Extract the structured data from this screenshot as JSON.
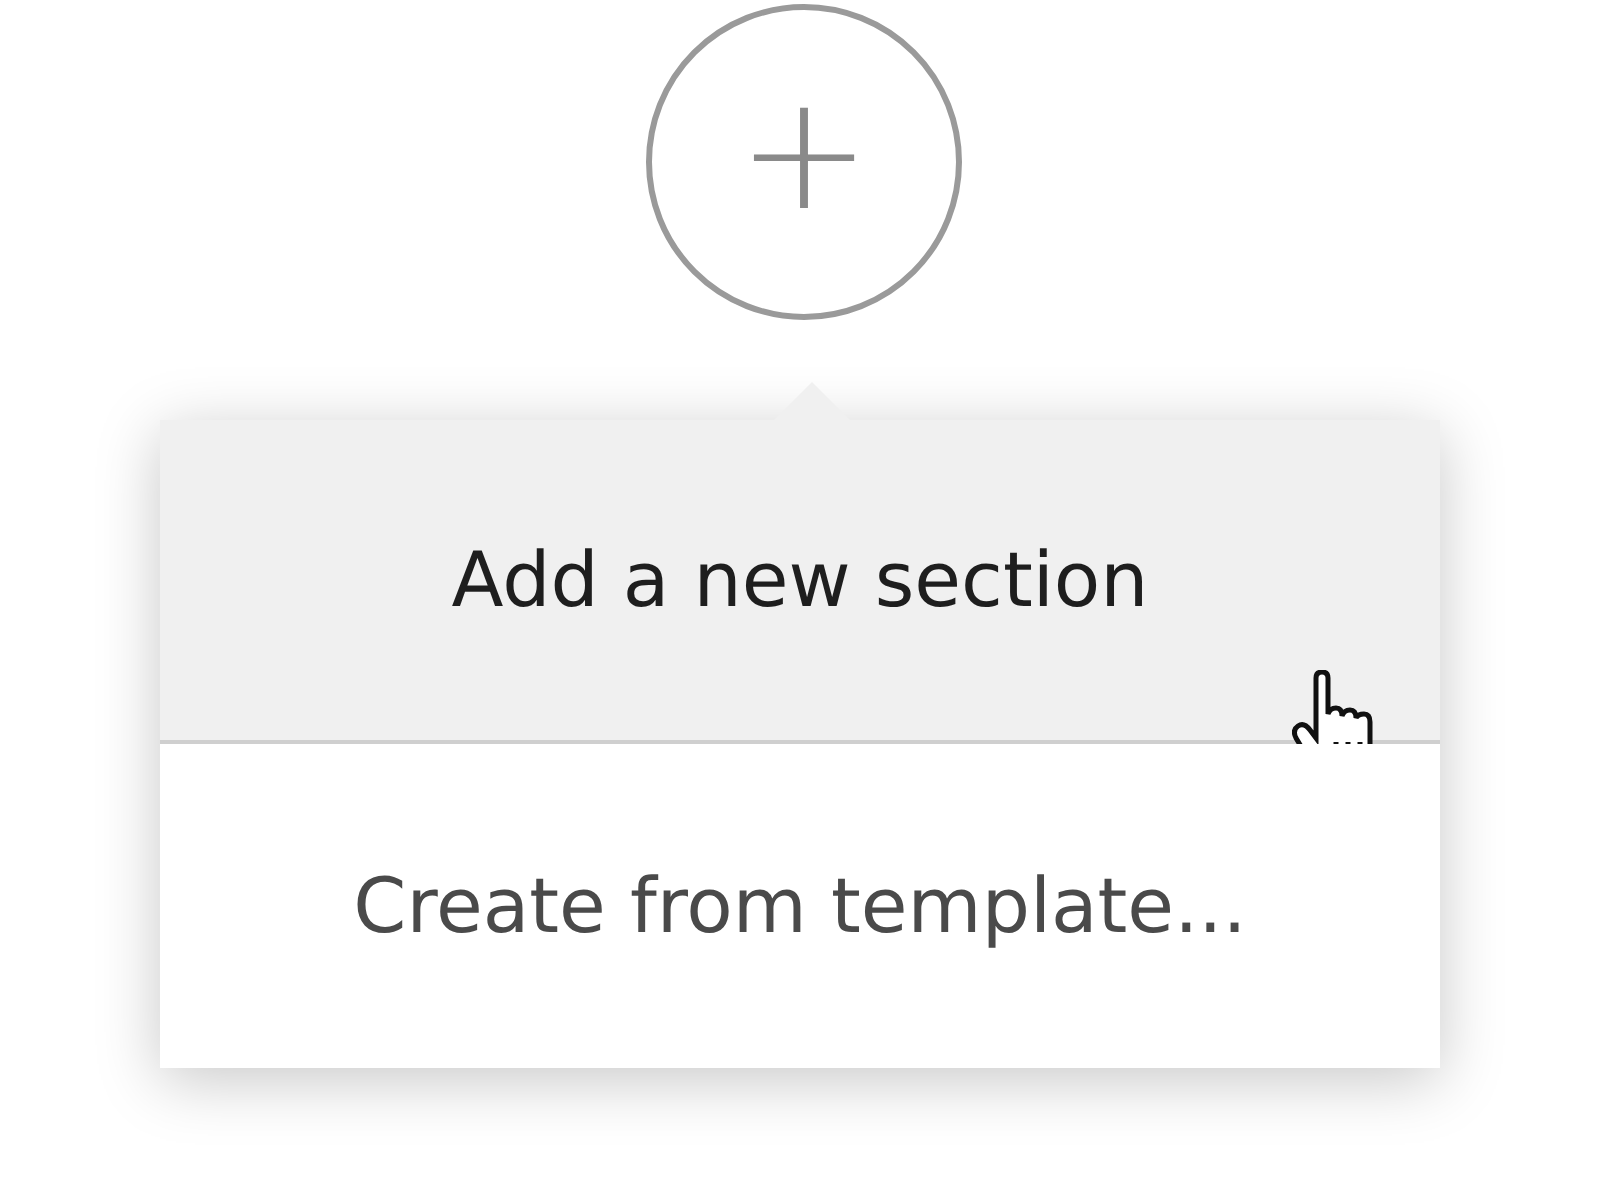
{
  "add_button": {
    "label": "+"
  },
  "menu": {
    "items": [
      {
        "label": "Add a new section",
        "hovered": true
      },
      {
        "label": "Create from template...",
        "hovered": false
      }
    ]
  }
}
